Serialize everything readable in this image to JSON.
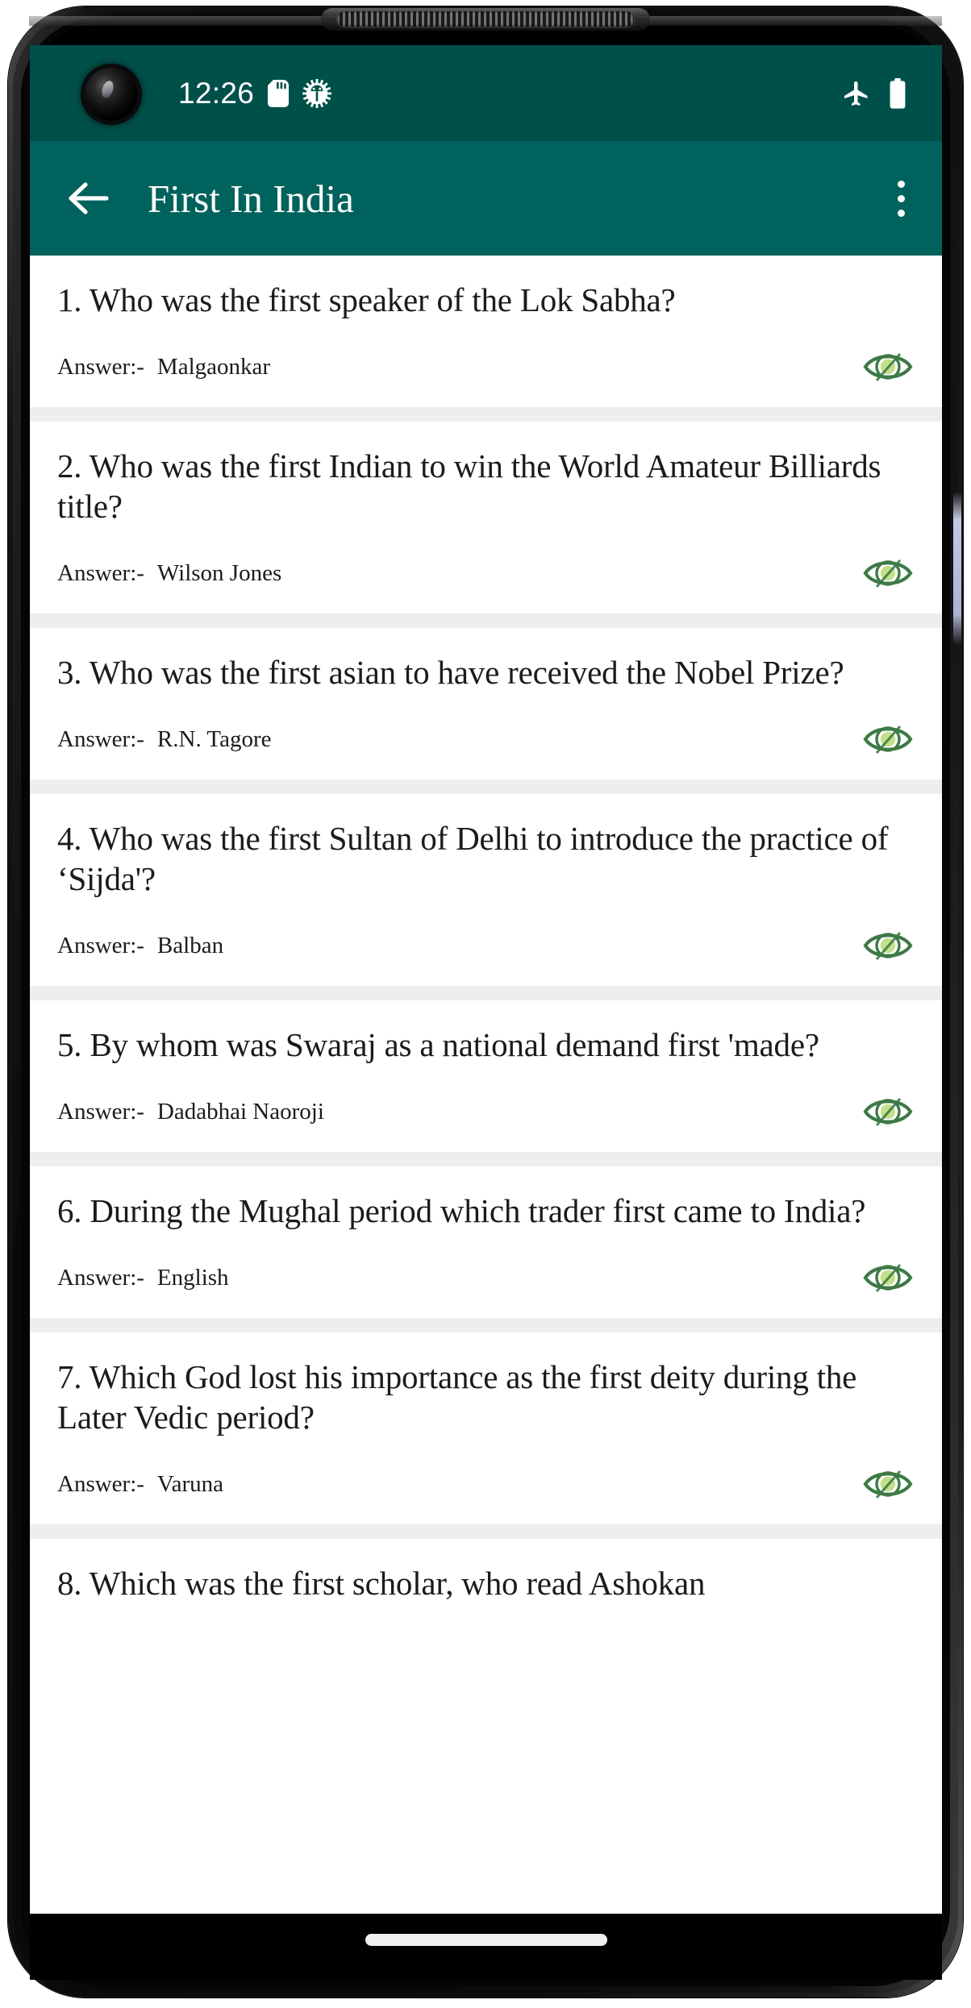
{
  "status_bar": {
    "time": "12:26",
    "icons": [
      {
        "name": "sd-card-icon"
      },
      {
        "name": "android-debug-bug-icon"
      }
    ],
    "right_icons": [
      {
        "name": "airplane-mode-icon"
      },
      {
        "name": "battery-full-icon"
      }
    ],
    "background_color": "#00504a"
  },
  "app_bar": {
    "back_label": "back-arrow",
    "title": "First In India",
    "overflow_label": "more-options",
    "background_color": "#00625c",
    "text_color": "#ffffff"
  },
  "list": {
    "answer_label": "Answer:-",
    "reveal_icon": "eye-icon",
    "eye_outline_color": "#3d7a46",
    "eye_iris_color": "#c3e08a",
    "items": [
      {
        "question": "1. Who was the first speaker of the Lok Sabha?",
        "answer": "Malgaonkar"
      },
      {
        "question": "2. Who was the first Indian to win the World Amateur Billiards title?",
        "answer": "Wilson Jones"
      },
      {
        "question": "3. Who was the first asian to have received the Nobel Prize?",
        "answer": "R.N. Tagore"
      },
      {
        "question": "4. Who was the first Sultan of Delhi to introduce the practice of ‘Sijda'?",
        "answer": "Balban"
      },
      {
        "question": "5. By whom was Swaraj as a national demand first 'made?",
        "answer": "Dadabhai Naoroji"
      },
      {
        "question": "6. During the Mughal period which trader first came to India?",
        "answer": "English"
      },
      {
        "question": "7. Which God lost his importance as the first deity during the Later Vedic period?",
        "answer": "Varuna"
      },
      {
        "question": "8. Which was the first scholar, who read Ashokan",
        "answer": ""
      }
    ]
  },
  "nav_bar": {
    "home_indicator": "home-gesture-pill"
  }
}
